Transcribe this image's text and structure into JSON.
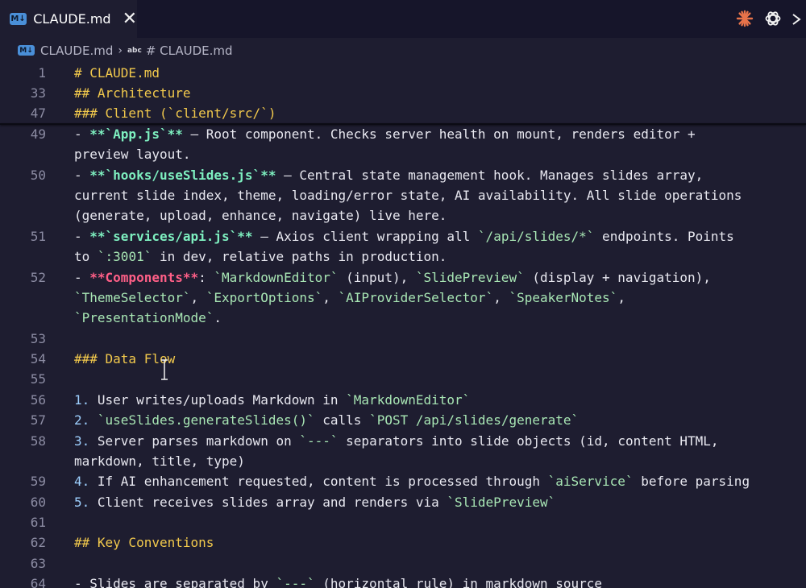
{
  "tab": {
    "badge": "M↓",
    "title": "CLAUDE.md",
    "close": "✕"
  },
  "top_icons": [
    "claude-logo-icon",
    "openai-logo-icon",
    "chevron-icon"
  ],
  "breadcrumb": {
    "badge": "M↓",
    "file": "CLAUDE.md",
    "chevron": "›",
    "symbol_badge": "abc",
    "symbol": "# CLAUDE.md"
  },
  "colors": {
    "heading": "#f2c94c",
    "bold_teal": "#7ef0c0",
    "bold_pink": "#ff5f87",
    "inline_code": "#a8e6b4",
    "line_number": "#8c8ca3",
    "background": "#1e1d30"
  },
  "sticky": [
    {
      "ln": "1",
      "text": "# CLAUDE.md"
    },
    {
      "ln": "33",
      "text": "## Architecture"
    },
    {
      "ln": "47",
      "text": "### Client (`client/src/`)"
    }
  ],
  "lines": {
    "l49a": {
      "ln": "49",
      "pre": "- ",
      "b1": "**",
      "bold": "`App.js`",
      "b2": "**",
      "rest": " — Root component. Checks server health on mount, renders editor +"
    },
    "l49b": "preview layout.",
    "l50a": {
      "ln": "50",
      "pre": "- ",
      "b1": "**",
      "bold": "`hooks/useSlides.js`",
      "b2": "**",
      "rest": " — Central state management hook. Manages slides array,"
    },
    "l50b": "current slide index, theme, loading/error state, AI availability. All slide operations",
    "l50c": "(generate, upload, enhance, navigate) live here.",
    "l51a": {
      "ln": "51",
      "pre": "- ",
      "b1": "**",
      "bold": "`services/api.js`",
      "b2": "**",
      "rest1": " — Axios client wrapping all ",
      "code1": "`/api/slides/*`",
      "rest2": " endpoints. Points"
    },
    "l51b": {
      "pre": "to ",
      "code": "`:3001`",
      "rest": " in dev, relative paths in production."
    },
    "l52a": {
      "ln": "52",
      "pre": "- ",
      "b1": "**",
      "bold": "Components",
      "b2": "**",
      "rest1": ": ",
      "c1": "`MarkdownEditor`",
      "rest2": " (input), ",
      "c2": "`SlidePreview`",
      "rest3": " (display + navigation),"
    },
    "l52b": {
      "c1": "`ThemeSelector`",
      "s1": ", ",
      "c2": "`ExportOptions`",
      "s2": ", ",
      "c3": "`AIProviderSelector`",
      "s3": ", ",
      "c4": "`SpeakerNotes`",
      "s4": ","
    },
    "l52c": {
      "c1": "`PresentationMode`",
      "s1": "."
    },
    "l53": {
      "ln": "53"
    },
    "l54": {
      "ln": "54",
      "text": "### Data Flow"
    },
    "l55": {
      "ln": "55"
    },
    "l56": {
      "ln": "56",
      "num": "1.",
      "rest": " User writes/uploads Markdown in ",
      "code": "`MarkdownEditor`"
    },
    "l57": {
      "ln": "57",
      "num": "2.",
      "sp": " ",
      "code1": "`useSlides.generateSlides()`",
      "rest": " calls ",
      "code2": "`POST /api/slides/generate`"
    },
    "l58a": {
      "ln": "58",
      "num": "3.",
      "rest1": " Server parses markdown on ",
      "code": "`---`",
      "rest2": " separators into slide objects (id, content HTML,"
    },
    "l58b": "markdown, title, type)",
    "l59": {
      "ln": "59",
      "num": "4.",
      "rest1": " If AI enhancement requested, content is processed through ",
      "code": "`aiService`",
      "rest2": " before parsing"
    },
    "l60": {
      "ln": "60",
      "num": "5.",
      "rest": " Client receives slides array and renders via ",
      "code": "`SlidePreview`"
    },
    "l61": {
      "ln": "61"
    },
    "l62": {
      "ln": "62",
      "text": "## Key Conventions"
    },
    "l63": {
      "ln": "63"
    },
    "l64": {
      "ln": "64",
      "pre": "- Slides are separated by ",
      "code": "`---`",
      "rest": " (horizontal rule) in markdown source"
    }
  }
}
